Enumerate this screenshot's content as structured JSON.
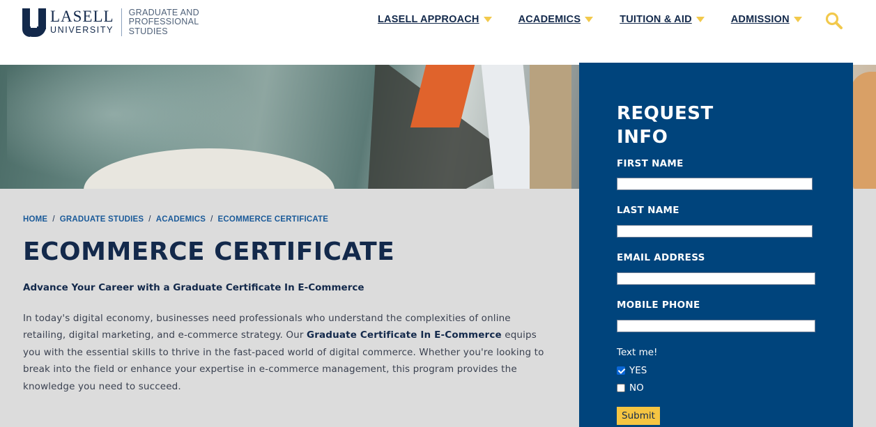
{
  "brand": {
    "name": "LASELL",
    "university": "UNIVERSITY",
    "subtitle": "GRADUATE AND PROFESSIONAL STUDIES"
  },
  "nav": {
    "items": [
      {
        "label": "LASELL APPROACH"
      },
      {
        "label": "ACADEMICS"
      },
      {
        "label": "TUITION & AID"
      },
      {
        "label": "ADMISSION"
      }
    ],
    "search_icon": "search-icon"
  },
  "breadcrumb": {
    "items": [
      "HOME",
      "GRADUATE STUDIES",
      "ACADEMICS",
      "ECOMMERCE CERTIFICATE"
    ],
    "separator": "/"
  },
  "main": {
    "title": "ECOMMERCE CERTIFICATE",
    "lead": "Advance Your Career with a Graduate Certificate In E-Commerce",
    "body_before": "In today's digital economy, businesses need professionals who understand the complexities of online retailing, digital marketing, and e-commerce strategy. Our ",
    "body_bold": "Graduate Certificate In E-Commerce",
    "body_after": " equips you with the essential skills to thrive in the fast-paced world of digital commerce. Whether you're looking to break into the field or enhance your expertise in e-commerce management, this program provides the knowledge you need to succeed."
  },
  "form": {
    "title_line1": "REQUEST",
    "title_line2": "INFO",
    "first_name_label": "FIRST NAME",
    "first_name_value": "",
    "last_name_label": "LAST NAME",
    "last_name_value": "",
    "email_label": "EMAIL ADDRESS",
    "email_value": "",
    "phone_label": "MOBILE PHONE",
    "phone_value": "",
    "text_me_label": "Text me!",
    "yes_label": "YES",
    "yes_checked": true,
    "no_label": "NO",
    "no_checked": false,
    "submit_label": "Submit"
  },
  "colors": {
    "navy": "#13294b",
    "panel_blue": "#00447c",
    "accent_gold": "#f2c94c",
    "content_gray": "#dcdcdc",
    "link_blue": "#1a5a99"
  }
}
